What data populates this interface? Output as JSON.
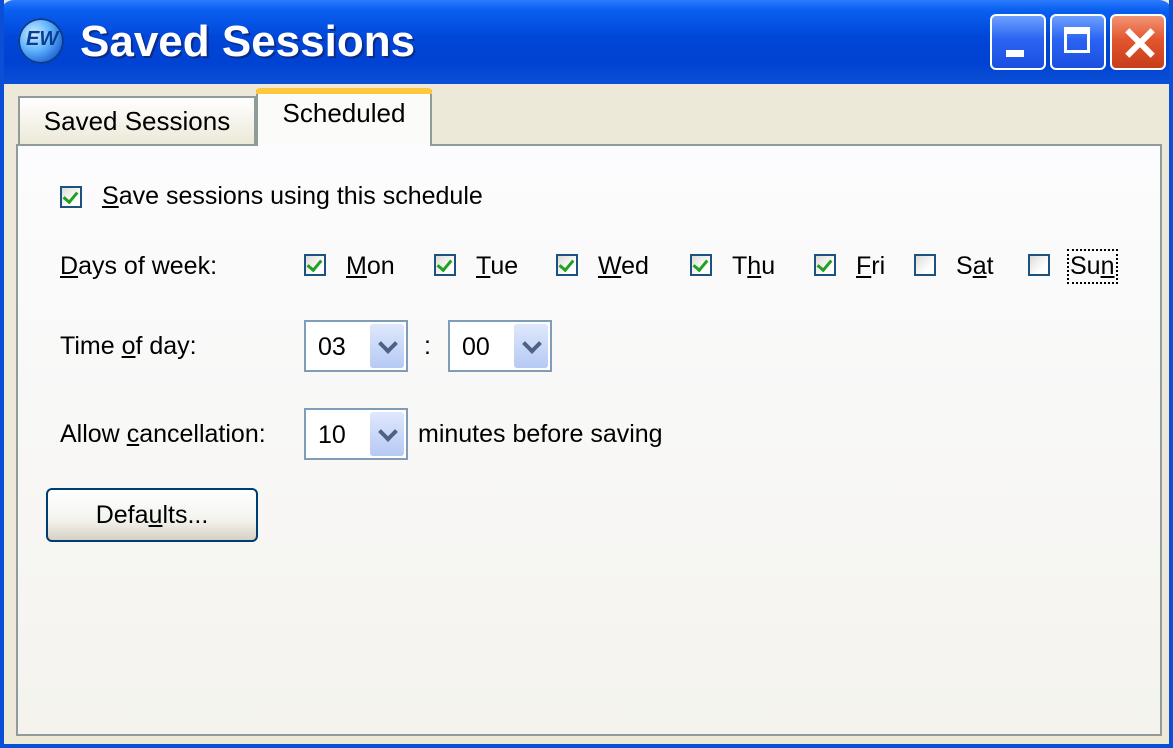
{
  "window": {
    "title": "Saved Sessions",
    "app_icon_text": "EW"
  },
  "tabs": [
    {
      "label": "Saved Sessions",
      "active": false
    },
    {
      "label": "Scheduled",
      "active": true
    }
  ],
  "schedule": {
    "enable": {
      "label": "Save sessions using this schedule",
      "checked": true
    },
    "days_label": "Days of week:",
    "days": [
      {
        "label": "Mon",
        "checked": true
      },
      {
        "label": "Tue",
        "checked": true
      },
      {
        "label": "Wed",
        "checked": true
      },
      {
        "label": "Thu",
        "checked": true
      },
      {
        "label": "Fri",
        "checked": true
      },
      {
        "label": "Sat",
        "checked": false
      },
      {
        "label": "Sun",
        "checked": false
      }
    ],
    "time_label": "Time of day:",
    "hour": "03",
    "separator": ":",
    "minute": "00",
    "cancel_label": "Allow cancellation:",
    "cancel_minutes": "10",
    "cancel_suffix": "minutes before saving"
  },
  "buttons": {
    "defaults": "Defaults..."
  }
}
